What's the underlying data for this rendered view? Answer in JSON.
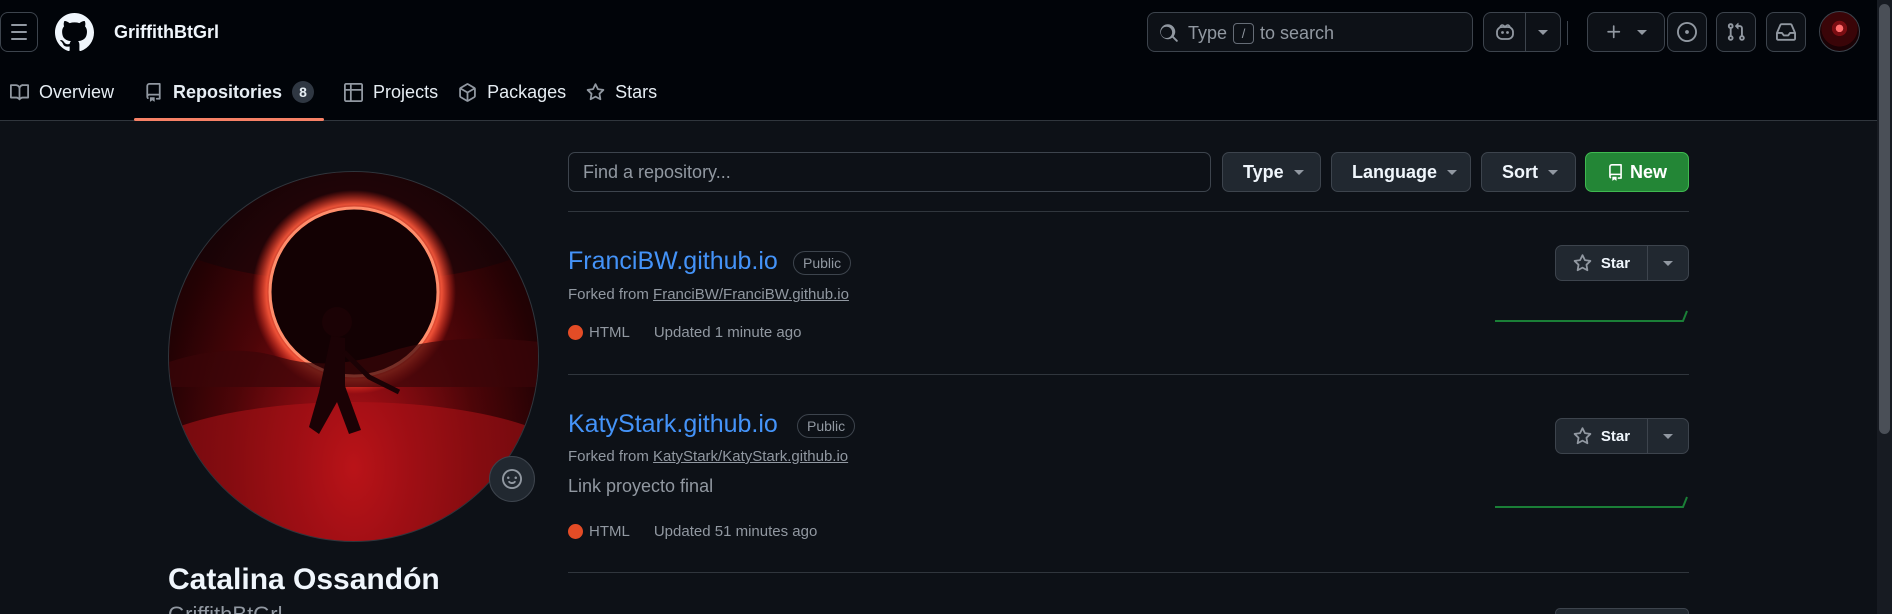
{
  "header": {
    "username": "GriffithBtGrl",
    "search_prefix": "Type",
    "search_key": "/",
    "search_suffix": "to search"
  },
  "tabs": [
    {
      "label": "Overview"
    },
    {
      "label": "Repositories",
      "count": "8"
    },
    {
      "label": "Projects"
    },
    {
      "label": "Packages"
    },
    {
      "label": "Stars"
    }
  ],
  "profile": {
    "full_name": "Catalina Ossandón",
    "login": "GriffithBtGrl"
  },
  "filters": {
    "find_placeholder": "Find a repository...",
    "type_label": "Type",
    "language_label": "Language",
    "sort_label": "Sort",
    "new_label": "New"
  },
  "repos": [
    {
      "name": "FranciBW.github.io",
      "visibility": "Public",
      "forked_prefix": "Forked from",
      "forked_from": "FranciBW/FranciBW.github.io",
      "description": "",
      "language": "HTML",
      "updated": "Updated 1 minute ago",
      "star_label": "Star"
    },
    {
      "name": "KatyStark.github.io",
      "visibility": "Public",
      "forked_prefix": "Forked from",
      "forked_from": "KatyStark/KatyStark.github.io",
      "description": "Link proyecto final",
      "language": "HTML",
      "updated": "Updated 51 minutes ago",
      "star_label": "Star"
    }
  ],
  "colors": {
    "accent_link": "#4493f8",
    "tab_underline": "#f78166",
    "new_button": "#238636",
    "html_language": "#e34c26",
    "activity_line": "#1a7f37"
  }
}
